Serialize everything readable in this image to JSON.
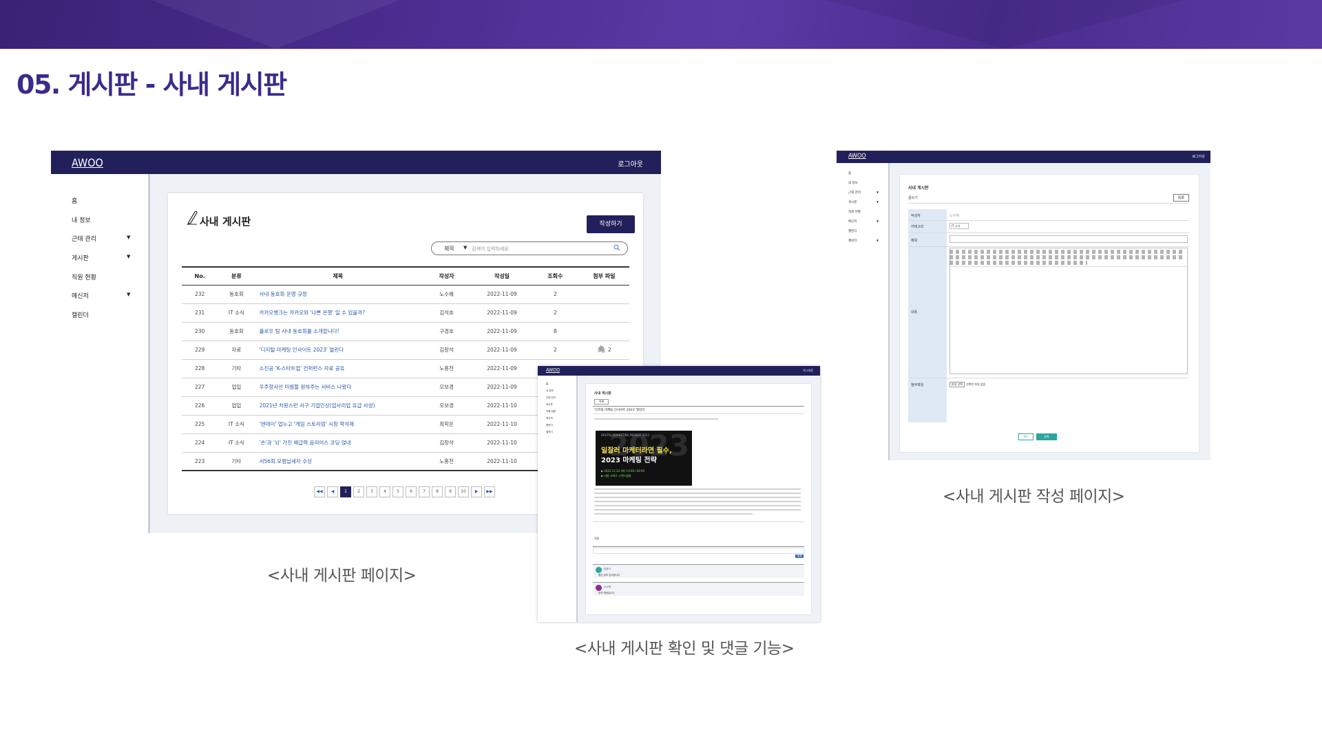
{
  "slide": {
    "title": "05. 게시판 - 사내 게시판",
    "captions": {
      "list": "<사내 게시판 페이지>",
      "write": "<사내 게시판 작성 페이지>",
      "detail": "<사내 게시판 확인 및 댓글 기능>"
    }
  },
  "list_screen": {
    "logo": "AWOO",
    "logout": "로그아웃",
    "sidebar": [
      "홈",
      "내 정보",
      "근태 관리",
      "게시판",
      "직원 현황",
      "메신저",
      "캘린더"
    ],
    "board_title": "사내 게시판",
    "write_button": "작성하기",
    "search": {
      "category": "제목",
      "placeholder": "검색어 입력하세요"
    },
    "columns": [
      "No.",
      "분류",
      "제목",
      "작성자",
      "작성일",
      "조회수",
      "첨부 파일"
    ],
    "rows": [
      {
        "no": "232",
        "cat": "동호회",
        "title": "사내 동호회 운영 규정",
        "author": "노수혜",
        "date": "2022-11-09",
        "views": "2",
        "attach": ""
      },
      {
        "no": "231",
        "cat": "IT 소식",
        "title": "카카오뱅크는 카카오와 '나쁜 은행' 일 수 있을까?",
        "author": "김석호",
        "date": "2022-11-09",
        "views": "2",
        "attach": ""
      },
      {
        "no": "230",
        "cat": "동호회",
        "title": "플로우 팀 사내 동호회를 소개합니다!",
        "author": "구경호",
        "date": "2022-11-09",
        "views": "8",
        "attach": ""
      },
      {
        "no": "229",
        "cat": "자료",
        "title": "'디지털 마케팅 인사이트 2023' 열린다",
        "author": "김창석",
        "date": "2022-11-09",
        "views": "2",
        "attach": "2"
      },
      {
        "no": "228",
        "cat": "기타",
        "title": "소진공 'K-스타트업' 컨퍼런스 자료 공유",
        "author": "노홍천",
        "date": "2022-11-09",
        "views": "",
        "attach": ""
      },
      {
        "no": "227",
        "cat": "업입",
        "title": "우주항사선 미뤘할 원하주는 서비스 나왔다",
        "author": "오보경",
        "date": "2022-11-09",
        "views": "",
        "attach": ""
      },
      {
        "no": "226",
        "cat": "업입",
        "title": "2021년 차원스런 서구 기업인상(업사리업 유급 사성)",
        "author": "오보경",
        "date": "2022-11-10",
        "views": "",
        "attach": ""
      },
      {
        "no": "225",
        "cat": "IT 소식",
        "title": "'엔데이' 업누고 '게임 스토리엄' 시창 학석제",
        "author": "최학운",
        "date": "2022-11-10",
        "views": "",
        "attach": ""
      },
      {
        "no": "224",
        "cat": "IT 소식",
        "title": "'손'과 '뇌' 가진 배급력 음리어스 코딩 얹내",
        "author": "김창석",
        "date": "2022-11-10",
        "views": "",
        "attach": ""
      },
      {
        "no": "223",
        "cat": "기타",
        "title": "서56회 모범납세자 수상",
        "author": "노홍천",
        "date": "2022-11-10",
        "views": "",
        "attach": ""
      }
    ],
    "pager": [
      "◀◀",
      "◀",
      "1",
      "2",
      "3",
      "4",
      "5",
      "6",
      "7",
      "8",
      "9",
      "10",
      "▶",
      "▶▶"
    ]
  },
  "write_screen": {
    "logo": "AWOO",
    "logout": "로그아웃",
    "sidebar": [
      "홈",
      "내 정보",
      "근태 관리",
      "게시판",
      "직원 현황",
      "메신저",
      "캘린더",
      "캘린더"
    ],
    "card_title": "사내 게시판",
    "sub_label": "글쓰기",
    "top_button": "목록",
    "labels": [
      "작성자",
      "카테고리",
      "제목",
      "내용",
      "첨부파일"
    ],
    "author_value": "노수혜",
    "category_value": "IT 소식",
    "file_button": "파일 선택",
    "file_text": "선택된 파일 없음",
    "cancel": "취소",
    "save": "등록"
  },
  "detail_screen": {
    "logo": "AWOO",
    "logout": "로그아웃",
    "card_title": "사내 게시판",
    "list_button": "목록",
    "post_title": "'디지털 마케팅 인사이트 2023' 열린다",
    "promo": {
      "big": "2023",
      "small": "DIGITAL MARKETING INSIGHT 2023",
      "line1": "일잘러 마케터라면 필수,",
      "line2": "2023 마케팅 전략",
      "green1": "▶ 2022.11.22 (화) 13:00~18:00",
      "green2": "▶ 서울 코엑스 그랜드볼룸"
    },
    "comment_label": "댓글",
    "submit": "등록",
    "comments": [
      {
        "name": "김창석",
        "text": "좋은 정보 감사합니다",
        "color": "#2aa6a0"
      },
      {
        "name": "노수혜",
        "text": "참석 예정입니다",
        "color": "#8a2b8f"
      }
    ]
  },
  "colors": {
    "title": "#3b2b8c",
    "navbar": "#22205a",
    "accent_teal": "#2aa6a0",
    "link_blue": "#2855a8"
  }
}
